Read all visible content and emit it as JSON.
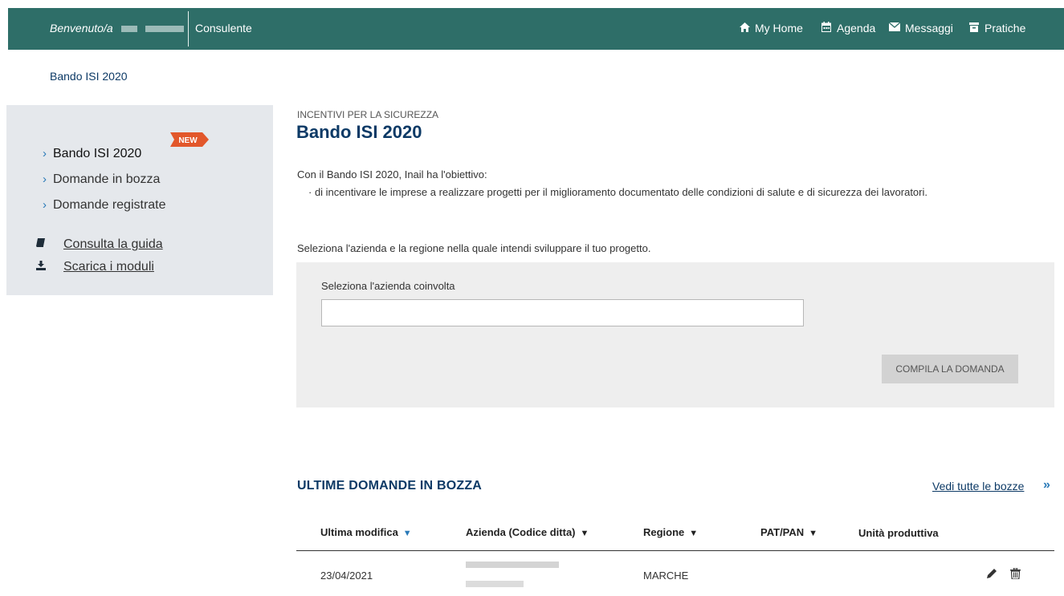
{
  "header": {
    "welcome": "Benvenuto/a",
    "role": "Consulente",
    "nav": [
      {
        "label": "My Home",
        "icon": "home-icon"
      },
      {
        "label": "Agenda",
        "icon": "calendar-icon"
      },
      {
        "label": "Messaggi",
        "icon": "envelope-icon"
      },
      {
        "label": "Pratiche",
        "icon": "archive-icon"
      }
    ],
    "bar_color": "#2e6e68"
  },
  "breadcrumb": "Bando ISI 2020",
  "sidebar": {
    "items": [
      {
        "label": "Bando ISI 2020",
        "active": true
      },
      {
        "label": "Domande in bozza",
        "active": false
      },
      {
        "label": "Domande registrate",
        "active": false
      }
    ],
    "links": [
      {
        "label": "Consulta la guida",
        "icon": "book-icon",
        "badge": "NEW"
      },
      {
        "label": "Scarica i moduli",
        "icon": "download-icon"
      }
    ]
  },
  "main": {
    "kicker": "INCENTIVI PER LA SICUREZZA",
    "title": "Bando ISI 2020",
    "intro": "Con il Bando ISI 2020, Inail ha l'obiettivo:",
    "bullet": "· di incentivare le imprese a realizzare progetti per il miglioramento documentato delle condizioni di salute e di sicurezza dei lavoratori.",
    "instruction": "Seleziona l'azienda e la regione nella quale intendi sviluppare il tuo progetto.",
    "form": {
      "label": "Seleziona l'azienda coinvolta",
      "value": "",
      "button": "COMPILA LA DOMANDA"
    }
  },
  "drafts": {
    "title": "ULTIME DOMANDE IN BOZZA",
    "see_all": "Vedi tutte le bozze",
    "columns": [
      {
        "label": "Ultima modifica",
        "sortable": true,
        "active": true
      },
      {
        "label": "Azienda (Codice ditta)",
        "sortable": true
      },
      {
        "label": "Regione",
        "sortable": true
      },
      {
        "label": "PAT/PAN",
        "sortable": true
      },
      {
        "label": "Unità produttiva",
        "sortable": false
      }
    ],
    "rows": [
      {
        "date": "23/04/2021",
        "regione": "MARCHE"
      }
    ]
  }
}
